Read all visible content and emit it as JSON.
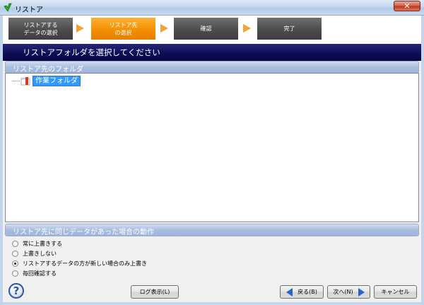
{
  "window": {
    "title": "リストア",
    "icon": "green-check-arrow-icon",
    "close_label": "✕"
  },
  "steps": [
    {
      "label": "リストアする\nデータの選択",
      "state": "done"
    },
    {
      "label": "リストア先\nの選択",
      "state": "active"
    },
    {
      "label": "確認",
      "state": "pending"
    },
    {
      "label": "完了",
      "state": "pending"
    }
  ],
  "banner": {
    "title": "リストアフォルダを選択してください"
  },
  "folder_section": {
    "header": "リストア先のフォルダ",
    "tree": [
      {
        "label": "作業フォルダ",
        "selected": true,
        "icon": "folder-icon"
      }
    ]
  },
  "conflict_section": {
    "header": "リストア先に同じデータがあった場合の動作",
    "options": [
      {
        "label": "常に上書きする",
        "checked": false
      },
      {
        "label": "上書きしない",
        "checked": false
      },
      {
        "label": "リストアするデータの方が新しい場合のみ上書き",
        "checked": true
      },
      {
        "label": "毎回確認する",
        "checked": false
      }
    ]
  },
  "footer": {
    "help_label": "?",
    "log_button": "ログ表示(L)",
    "back_button": "戻る(B)",
    "next_button": "次へ(N)",
    "cancel_button": "キャンセル"
  },
  "colors": {
    "step_active": "#f28d00",
    "step_inactive": "#4a4a4a",
    "banner": "#0c0c55",
    "selection": "#3399ff",
    "nav_arrow": "#2a66c8"
  }
}
